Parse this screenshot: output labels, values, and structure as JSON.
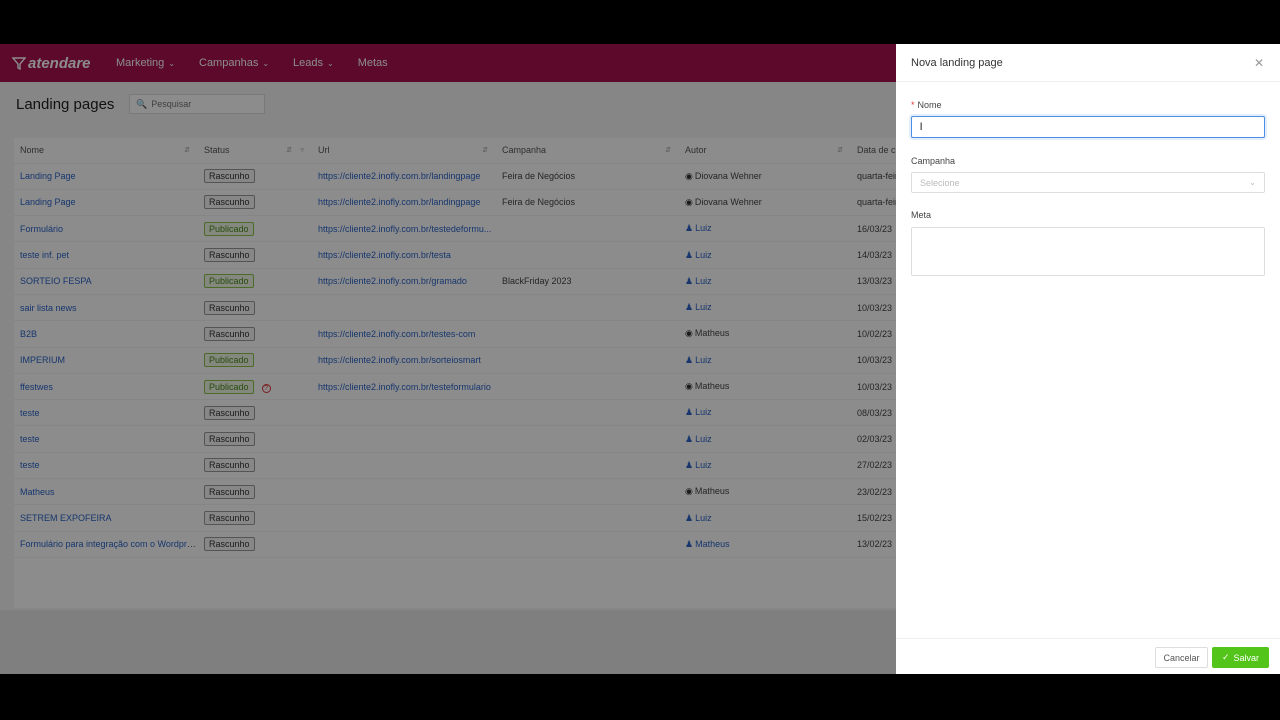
{
  "nav": {
    "logo": "atendare",
    "items": [
      {
        "label": "Marketing",
        "chevron": true
      },
      {
        "label": "Campanhas",
        "chevron": true
      },
      {
        "label": "Leads",
        "chevron": true
      },
      {
        "label": "Metas",
        "chevron": false
      }
    ]
  },
  "page": {
    "title": "Landing pages",
    "search_placeholder": "Pesquisar"
  },
  "table": {
    "columns": [
      "Nome",
      "Status",
      "Url",
      "Campanha",
      "Autor",
      "Data de cr"
    ],
    "rows": [
      {
        "nome": "Landing Page",
        "status": "Rascunho",
        "published": false,
        "warn": false,
        "url": "https://cliente2.inofly.com.br/landingpage",
        "campanha": "Feira de Negócios",
        "autor": "Diovana Wehner",
        "autor_icon": "group",
        "data": "quarta-feir"
      },
      {
        "nome": "Landing Page",
        "status": "Rascunho",
        "published": false,
        "warn": false,
        "url": "https://cliente2.inofly.com.br/landingpage",
        "campanha": "Feira de Negócios",
        "autor": "Diovana Wehner",
        "autor_icon": "group",
        "data": "quarta-feir"
      },
      {
        "nome": "Formulário",
        "status": "Publicado",
        "published": true,
        "warn": false,
        "url": "https://cliente2.inofly.com.br/testedeformu...",
        "campanha": "",
        "autor": "Luiz",
        "autor_icon": "user",
        "data": "16/03/23"
      },
      {
        "nome": "teste inf. pet",
        "status": "Rascunho",
        "published": false,
        "warn": false,
        "url": "https://cliente2.inofly.com.br/testa",
        "campanha": "",
        "autor": "Luiz",
        "autor_icon": "user",
        "data": "14/03/23"
      },
      {
        "nome": "SORTEIO FESPA",
        "status": "Publicado",
        "published": true,
        "warn": false,
        "url": "https://cliente2.inofly.com.br/gramado",
        "campanha": "BlackFriday 2023",
        "autor": "Luiz",
        "autor_icon": "user",
        "data": "13/03/23"
      },
      {
        "nome": "sair lista news",
        "status": "Rascunho",
        "published": false,
        "warn": false,
        "url": "",
        "campanha": "",
        "autor": "Luiz",
        "autor_icon": "user",
        "data": "10/03/23"
      },
      {
        "nome": "B2B",
        "status": "Rascunho",
        "published": false,
        "warn": false,
        "url": "https://cliente2.inofly.com.br/testes-com",
        "campanha": "",
        "autor": "Matheus",
        "autor_icon": "group",
        "data": "10/02/23"
      },
      {
        "nome": "IMPERIUM",
        "status": "Publicado",
        "published": true,
        "warn": false,
        "url": "https://cliente2.inofly.com.br/sorteiosmart",
        "campanha": "",
        "autor": "Luiz",
        "autor_icon": "user",
        "data": "10/03/23"
      },
      {
        "nome": "ffestwes",
        "status": "Publicado",
        "published": true,
        "warn": true,
        "url": "https://cliente2.inofly.com.br/testeformulario",
        "campanha": "",
        "autor": "Matheus",
        "autor_icon": "group",
        "data": "10/03/23"
      },
      {
        "nome": "teste",
        "status": "Rascunho",
        "published": false,
        "warn": false,
        "url": "",
        "campanha": "",
        "autor": "Luiz",
        "autor_icon": "user",
        "data": "08/03/23"
      },
      {
        "nome": "teste",
        "status": "Rascunho",
        "published": false,
        "warn": false,
        "url": "",
        "campanha": "",
        "autor": "Luiz",
        "autor_icon": "user",
        "data": "02/03/23"
      },
      {
        "nome": "teste",
        "status": "Rascunho",
        "published": false,
        "warn": false,
        "url": "",
        "campanha": "",
        "autor": "Luiz",
        "autor_icon": "user",
        "data": "27/02/23"
      },
      {
        "nome": "Matheus",
        "status": "Rascunho",
        "published": false,
        "warn": false,
        "url": "",
        "campanha": "",
        "autor": "Matheus",
        "autor_icon": "group",
        "data": "23/02/23"
      },
      {
        "nome": "SETREM EXPOFEIRA",
        "status": "Rascunho",
        "published": false,
        "warn": false,
        "url": "",
        "campanha": "",
        "autor": "Luiz",
        "autor_icon": "user",
        "data": "15/02/23"
      },
      {
        "nome": "Formulário para integração com o Wordpress",
        "status": "Rascunho",
        "published": false,
        "warn": false,
        "url": "",
        "campanha": "",
        "autor": "Matheus",
        "autor_icon": "user",
        "data": "13/02/23"
      }
    ]
  },
  "drawer": {
    "title": "Nova landing page",
    "nome_label": "Nome",
    "nome_value": "l",
    "campanha_label": "Campanha",
    "campanha_placeholder": "Selecione",
    "meta_label": "Meta",
    "cancel_label": "Cancelar",
    "save_label": "Salvar"
  },
  "colors": {
    "nav_bg": "#a8114f",
    "link": "#2a63c7",
    "save": "#52c41a"
  }
}
